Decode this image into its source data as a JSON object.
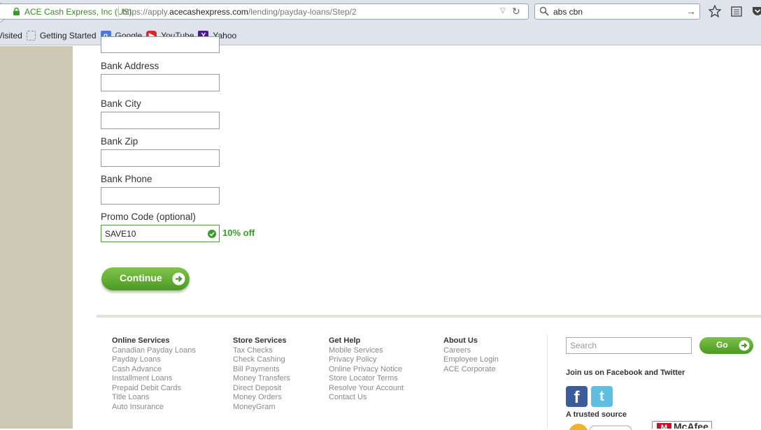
{
  "browser": {
    "site_identity": "ACE Cash Express, Inc (US)",
    "url_prefix": "https://apply.",
    "url_domain": "acecashexpress.com",
    "url_path": "/lending/payday-loans/Step/2",
    "search_value": "abs cbn",
    "bookmarks": [
      {
        "label": "Visited",
        "icon": "folder-icon"
      },
      {
        "label": "Getting Started",
        "icon": "dotted-page-icon"
      },
      {
        "label": "Google",
        "icon": "google-icon"
      },
      {
        "label": "YouTube",
        "icon": "youtube-icon"
      },
      {
        "label": "Yahoo",
        "icon": "yahoo-icon"
      }
    ]
  },
  "form": {
    "fields": [
      {
        "label": "Bank Address",
        "value": ""
      },
      {
        "label": "Bank City",
        "value": ""
      },
      {
        "label": "Bank Zip",
        "value": ""
      },
      {
        "label": "Bank Phone",
        "value": ""
      }
    ],
    "promo_label": "Promo Code (optional)",
    "promo_value": "SAVE10",
    "promo_note": "10% off",
    "continue_label": "Continue"
  },
  "footer": {
    "columns": [
      {
        "title": "Online Services",
        "links": [
          "Canadian Payday Loans",
          "Payday Loans",
          "Cash Advance",
          "Installment Loans",
          "Prepaid Debit Cards",
          "Title Loans",
          "Auto Insurance"
        ]
      },
      {
        "title": "Store Services",
        "links": [
          "Tax Checks",
          "Check Cashing",
          "Bill Payments",
          "Money Transfers",
          "Direct Deposit",
          "Money Orders",
          "MoneyGram"
        ]
      },
      {
        "title": "Get Help",
        "links": [
          "Mobile Services",
          "Privacy Policy",
          "Online Privacy Notice",
          "Store Locator Terms",
          "Resolve Your Account",
          "Contact Us"
        ]
      },
      {
        "title": "About Us",
        "links": [
          "Careers",
          "Employee Login",
          "ACE Corporate"
        ]
      }
    ],
    "search_placeholder": "Search",
    "go_label": "Go",
    "social_text": "Join us on Facebook and Twitter",
    "trusted_text": "A trusted source",
    "mcafee_text": "McAfee"
  },
  "colors": {
    "accent_green": "#4a9a24",
    "promo_green": "#3b9a2a",
    "stripe": "#cdc8b4"
  }
}
